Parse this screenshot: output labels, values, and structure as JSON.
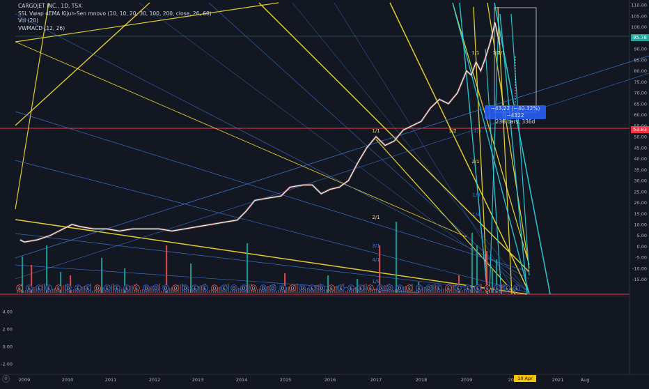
{
  "legend": {
    "title": "CARGOJET INC., 1D, TSX",
    "line2": "SSL Vwap 4EMA Kijun-Sen mnovo (10, 10, 20, 30, 100, 200, close, 26, 60)",
    "line3": "Vol (20)",
    "line4": "VWMACD (12, 26)"
  },
  "measure": {
    "line1": "−43.22 (−40.32%) −4322",
    "line2": "236 bars, 336d"
  },
  "price_tags": {
    "horizontal_level": "53.83",
    "last_price": "95.78"
  },
  "date_tag": "10 Apr '20",
  "gann_labels": [
    "1/1",
    "1/2",
    "1/1",
    "1/1",
    "1/2",
    "1/3",
    "2/1",
    "2/1",
    "3/1",
    "4/1",
    "1/3",
    "1/4",
    "1/8"
  ],
  "colors": {
    "background": "#131722",
    "red": "#f23645",
    "yellow": "#f5e030",
    "cyan": "#29d3e0",
    "blue": "#2962ff",
    "up": "#26a69a",
    "down": "#ef5350"
  },
  "icons": [
    "gear-icon"
  ],
  "chart_data": {
    "type": "line",
    "x_ticks": [
      "2009",
      "2010",
      "2011",
      "2012",
      "2013",
      "2014",
      "2015",
      "2016",
      "2017",
      "2018",
      "2019",
      "2020",
      "2021",
      "Aug"
    ],
    "y_ticks": [
      110,
      105,
      100,
      95,
      90,
      85,
      80,
      75,
      70,
      65,
      60,
      55,
      50,
      45,
      40,
      35,
      30,
      25,
      20,
      15,
      10,
      5,
      0,
      -5,
      -10,
      -15
    ],
    "ylim": [
      -17,
      111
    ],
    "macd_ticks": [
      "4.00",
      "2.00",
      "0.00",
      "-2.00"
    ],
    "series": [
      {
        "x": [
          2008.9,
          2009.0,
          2009.3,
          2009.6,
          2009.9,
          2010.1,
          2010.3,
          2010.6,
          2010.9,
          2011.2,
          2011.5,
          2011.8,
          2012.1,
          2012.4,
          2012.7,
          2013.0,
          2013.3,
          2013.6,
          2013.9,
          2014.1,
          2014.3,
          2014.6,
          2014.9,
          2015.1,
          2015.4,
          2015.6,
          2015.8,
          2016.0,
          2016.2,
          2016.4,
          2016.6,
          2016.8,
          2017.0,
          2017.2,
          2017.4,
          2017.6,
          2017.8,
          2018.0,
          2018.2,
          2018.4,
          2018.6,
          2018.8,
          2018.9,
          2019.0,
          2019.1,
          2019.2,
          2019.3,
          2019.4,
          2019.5,
          2019.6,
          2019.7
        ],
        "y": [
          3,
          2,
          3,
          5,
          8,
          10,
          9,
          8,
          8,
          7,
          8,
          8,
          8,
          7,
          8,
          9,
          10,
          11,
          12,
          16,
          21,
          22,
          23,
          27,
          28,
          28,
          24,
          26,
          27,
          30,
          38,
          45,
          50,
          46,
          48,
          53,
          55,
          57,
          63,
          67,
          65,
          70,
          75,
          80,
          78,
          84,
          80,
          86,
          93,
          102,
          92
        ]
      }
    ],
    "horizontal_level": 53.83,
    "grid": false,
    "legend": "top-left"
  }
}
